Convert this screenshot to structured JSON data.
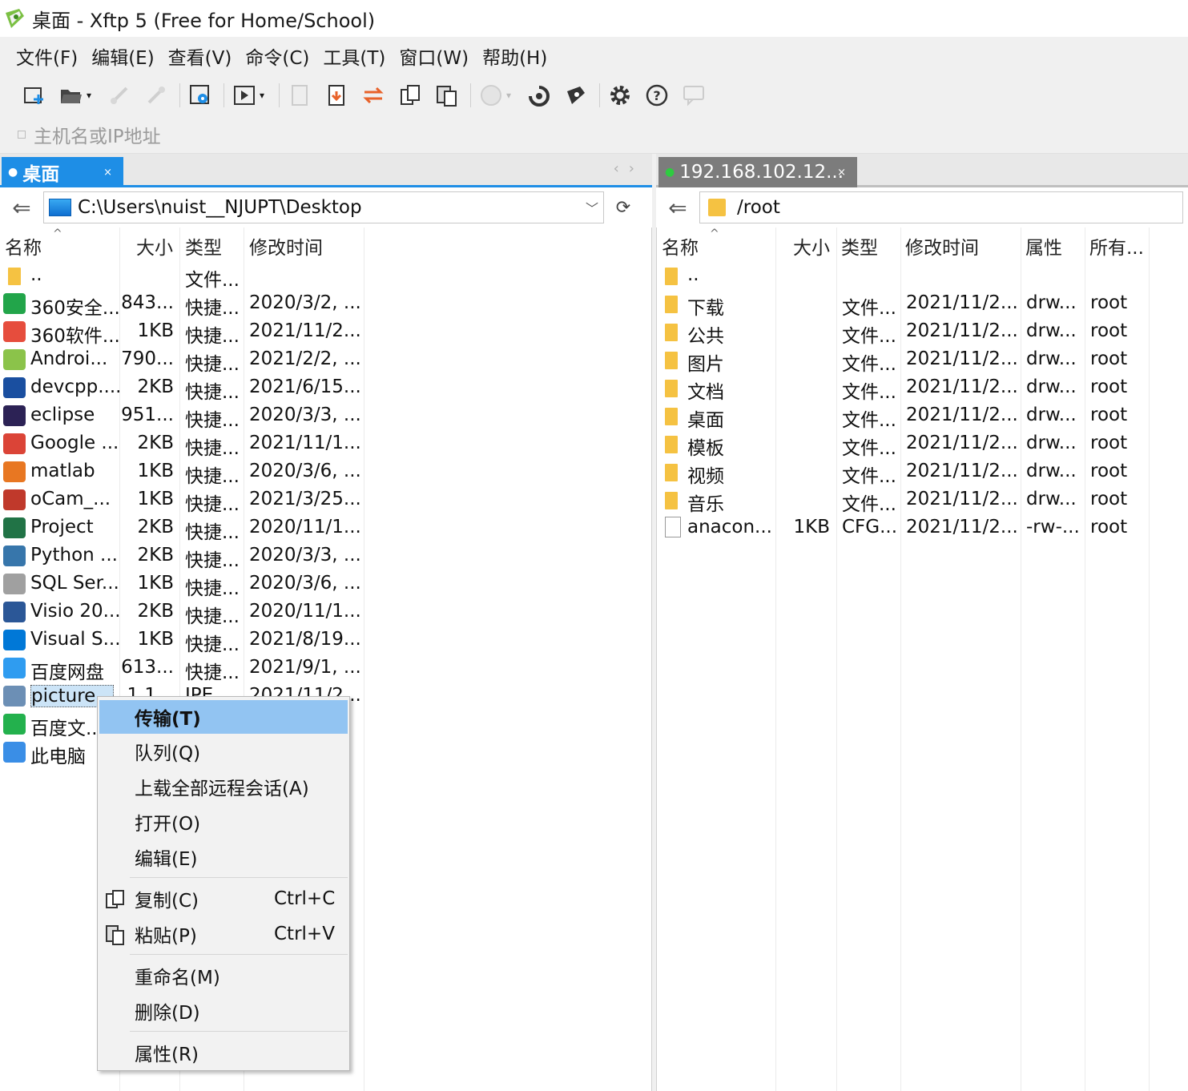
{
  "window": {
    "title": "桌面 - Xftp 5 (Free for Home/School)"
  },
  "menu": [
    "文件(F)",
    "编辑(E)",
    "查看(V)",
    "命令(C)",
    "工具(T)",
    "窗口(W)",
    "帮助(H)"
  ],
  "address": {
    "placeholder": "主机名或IP地址"
  },
  "tabs": {
    "left": {
      "label": "桌面",
      "close": "×"
    },
    "right": {
      "label": "192.168.102.12...",
      "close": "×"
    }
  },
  "left_pane": {
    "path": "C:\\Users\\nuist__NJUPT\\Desktop",
    "columns": [
      "名称",
      "大小",
      "类型",
      "修改时间"
    ],
    "rows": [
      {
        "name": "..",
        "size": "",
        "type": "文件...",
        "modified": ""
      },
      {
        "name": "360安全...",
        "size": "843...",
        "type": "快捷...",
        "modified": "2020/3/2, ..."
      },
      {
        "name": "360软件...",
        "size": "1KB",
        "type": "快捷...",
        "modified": "2021/11/2..."
      },
      {
        "name": "Androi...",
        "size": "790...",
        "type": "快捷...",
        "modified": "2021/2/2, ..."
      },
      {
        "name": "devcpp....",
        "size": "2KB",
        "type": "快捷...",
        "modified": "2021/6/15..."
      },
      {
        "name": "eclipse",
        "size": "951...",
        "type": "快捷...",
        "modified": "2020/3/3, ..."
      },
      {
        "name": "Google ...",
        "size": "2KB",
        "type": "快捷...",
        "modified": "2021/11/1..."
      },
      {
        "name": "matlab",
        "size": "1KB",
        "type": "快捷...",
        "modified": "2020/3/6, ..."
      },
      {
        "name": "oCam_...",
        "size": "1KB",
        "type": "快捷...",
        "modified": "2021/3/25..."
      },
      {
        "name": "Project",
        "size": "2KB",
        "type": "快捷...",
        "modified": "2020/11/1..."
      },
      {
        "name": "Python ...",
        "size": "2KB",
        "type": "快捷...",
        "modified": "2020/3/3, ..."
      },
      {
        "name": "SQL Ser...",
        "size": "1KB",
        "type": "快捷...",
        "modified": "2020/3/6, ..."
      },
      {
        "name": "Visio 20...",
        "size": "2KB",
        "type": "快捷...",
        "modified": "2020/11/1..."
      },
      {
        "name": "Visual S...",
        "size": "1KB",
        "type": "快捷...",
        "modified": "2021/8/19..."
      },
      {
        "name": "百度网盘",
        "size": "613...",
        "type": "快捷...",
        "modified": "2021/9/1, ..."
      },
      {
        "name": "picture...",
        "size": "1.1...",
        "type": "JPE...",
        "modified": "2021/11/2..."
      },
      {
        "name": "百度文...",
        "size": "",
        "type": "",
        "modified": "..."
      },
      {
        "name": "此电脑",
        "size": "",
        "type": "",
        "modified": "..."
      }
    ]
  },
  "right_pane": {
    "path": "/root",
    "columns": [
      "名称",
      "大小",
      "类型",
      "修改时间",
      "属性",
      "所有..."
    ],
    "rows": [
      {
        "name": "..",
        "size": "",
        "type": "",
        "modified": "",
        "attr": "",
        "owner": ""
      },
      {
        "name": "下载",
        "size": "",
        "type": "文件...",
        "modified": "2021/11/2...",
        "attr": "drw...",
        "owner": "root"
      },
      {
        "name": "公共",
        "size": "",
        "type": "文件...",
        "modified": "2021/11/2...",
        "attr": "drw...",
        "owner": "root"
      },
      {
        "name": "图片",
        "size": "",
        "type": "文件...",
        "modified": "2021/11/2...",
        "attr": "drw...",
        "owner": "root"
      },
      {
        "name": "文档",
        "size": "",
        "type": "文件...",
        "modified": "2021/11/2...",
        "attr": "drw...",
        "owner": "root"
      },
      {
        "name": "桌面",
        "size": "",
        "type": "文件...",
        "modified": "2021/11/2...",
        "attr": "drw...",
        "owner": "root"
      },
      {
        "name": "模板",
        "size": "",
        "type": "文件...",
        "modified": "2021/11/2...",
        "attr": "drw...",
        "owner": "root"
      },
      {
        "name": "视频",
        "size": "",
        "type": "文件...",
        "modified": "2021/11/2...",
        "attr": "drw...",
        "owner": "root"
      },
      {
        "name": "音乐",
        "size": "",
        "type": "文件...",
        "modified": "2021/11/2...",
        "attr": "drw...",
        "owner": "root"
      },
      {
        "name": "anacon...",
        "size": "1KB",
        "type": "CFG...",
        "modified": "2021/11/2...",
        "attr": "-rw-...",
        "owner": "root"
      }
    ]
  },
  "context_menu": {
    "items": [
      {
        "label": "传输(T)",
        "shortcut": ""
      },
      {
        "label": "队列(Q)",
        "shortcut": ""
      },
      {
        "label": "上载全部远程会话(A)",
        "shortcut": ""
      },
      {
        "label": "打开(O)",
        "shortcut": ""
      },
      {
        "label": "编辑(E)",
        "shortcut": ""
      },
      {
        "label": "复制(C)",
        "shortcut": "Ctrl+C"
      },
      {
        "label": "粘贴(P)",
        "shortcut": "Ctrl+V"
      },
      {
        "label": "重命名(M)",
        "shortcut": ""
      },
      {
        "label": "删除(D)",
        "shortcut": ""
      },
      {
        "label": "属性(R)",
        "shortcut": ""
      }
    ]
  },
  "colors": {
    "accent": "#1e8ee6",
    "menu_highlight": "#92c4f2",
    "folder": "#f5c242"
  },
  "left_icons": [
    "360-safe-icon",
    "360-soft-icon",
    "android-icon",
    "devcpp-icon",
    "eclipse-icon",
    "chrome-icon",
    "matlab-icon",
    "ocam-icon",
    "project-icon",
    "python-icon",
    "sqlserver-icon",
    "visio-icon",
    "vscode-icon",
    "baidu-netdisk-icon",
    "image-file-icon",
    "baidu-wenku-icon",
    "this-pc-icon"
  ]
}
